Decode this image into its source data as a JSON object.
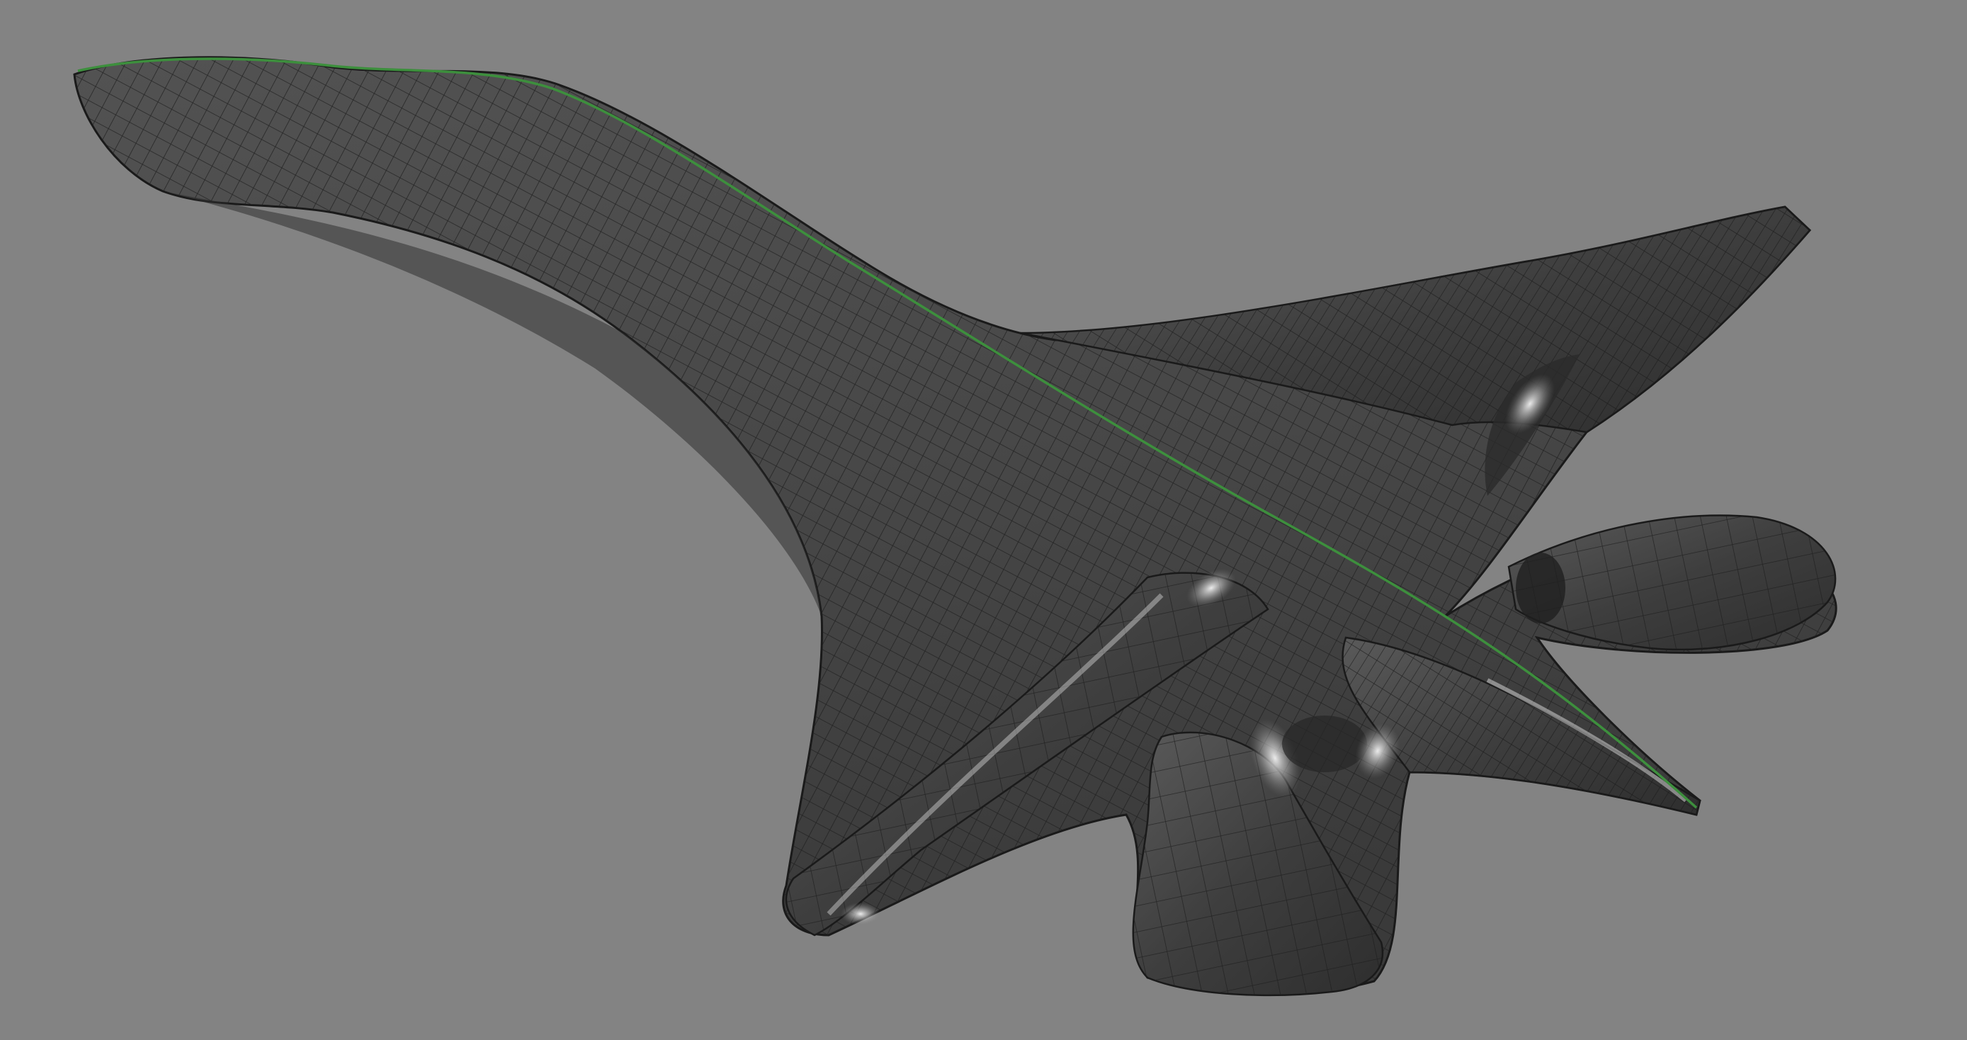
{
  "viewport": {
    "background_color": "#838383",
    "display_mode": "shaded-with-isocurves"
  },
  "model": {
    "surface_color": "#4b4b4b",
    "surface_highlight_color": "#9a9a9a",
    "isocurve_color": "#1c1c1c",
    "selected_edge_color": "#3d8f3d",
    "selected": true
  }
}
